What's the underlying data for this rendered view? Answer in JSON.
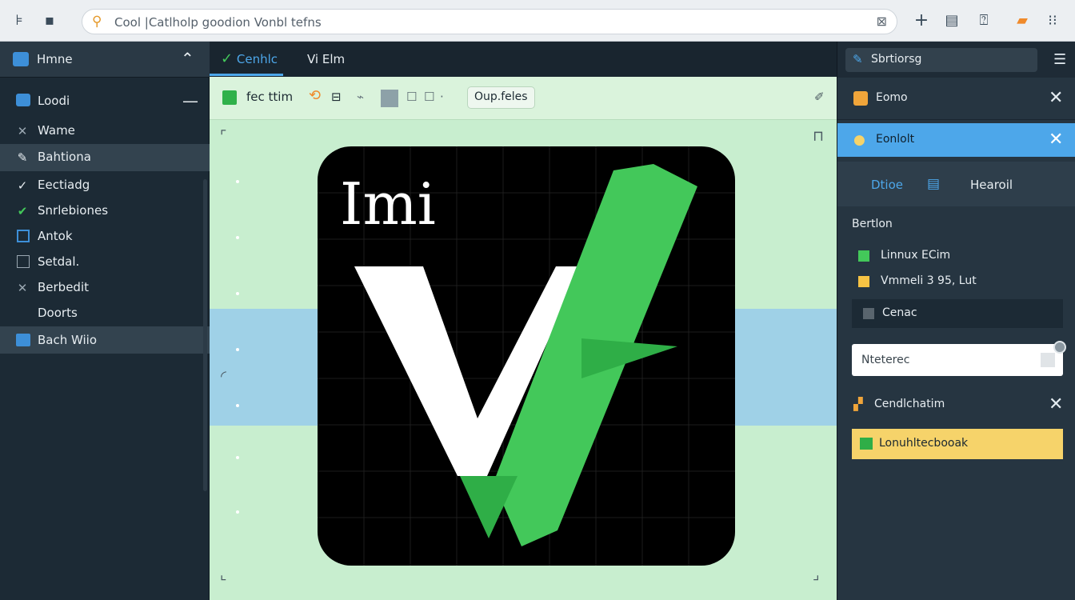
{
  "topbar": {
    "url_text": "Cool |Catlholp goodion Vonbl tefns",
    "icons": [
      "app-icon",
      "home-icon",
      "search-icon",
      "extension-icon",
      "add-icon",
      "window-icon",
      "profile-icon",
      "bookmark-icon",
      "menu-icon"
    ]
  },
  "sidebar": {
    "home_label": "Hmne",
    "items": [
      {
        "label": "Loodi",
        "icon": "folder-icon"
      },
      {
        "label": "Wame",
        "icon": "close-icon"
      },
      {
        "label": "Bahtiona",
        "icon": "check-icon"
      },
      {
        "label": "Eectiadg",
        "icon": "check-icon"
      },
      {
        "label": "Snrlebiones",
        "icon": "check-icon"
      },
      {
        "label": "Antok",
        "icon": "box-icon"
      },
      {
        "label": "Setdal.",
        "icon": "square-icon"
      },
      {
        "label": "Berbedit",
        "icon": "close-icon"
      },
      {
        "label": "Doorts",
        "icon": ""
      },
      {
        "label": "Bach Wiio",
        "icon": "grid-icon"
      }
    ]
  },
  "center": {
    "tabs": [
      {
        "label": "Cenhlc",
        "active": true
      },
      {
        "label": "Elm",
        "active": false
      }
    ],
    "tab2_prefix": "Vi",
    "toolbar": {
      "label": "fec ttim",
      "dropdown": "Oup.feles"
    },
    "logo_text": "Imi"
  },
  "right_panel": {
    "header": "Sbrtiorsg",
    "cards": [
      {
        "label": "Eomo"
      },
      {
        "label": "Eonlolt"
      }
    ],
    "tabs": [
      "Dtioe",
      "Hearoil"
    ],
    "section_title": "Bertlon",
    "options": [
      {
        "label": "Linnux ECim"
      },
      {
        "label": "Vmmeli 3 95, Lut"
      },
      {
        "label": "Cenac"
      }
    ],
    "search_placeholder": "Nteterec",
    "bottom_card": "Cendlchatim",
    "highlight_item": "Lonuhltecbooak"
  },
  "colors": {
    "accent_blue": "#4da7ea",
    "vim_green": "#43c85a",
    "yellow": "#f6d36a"
  }
}
